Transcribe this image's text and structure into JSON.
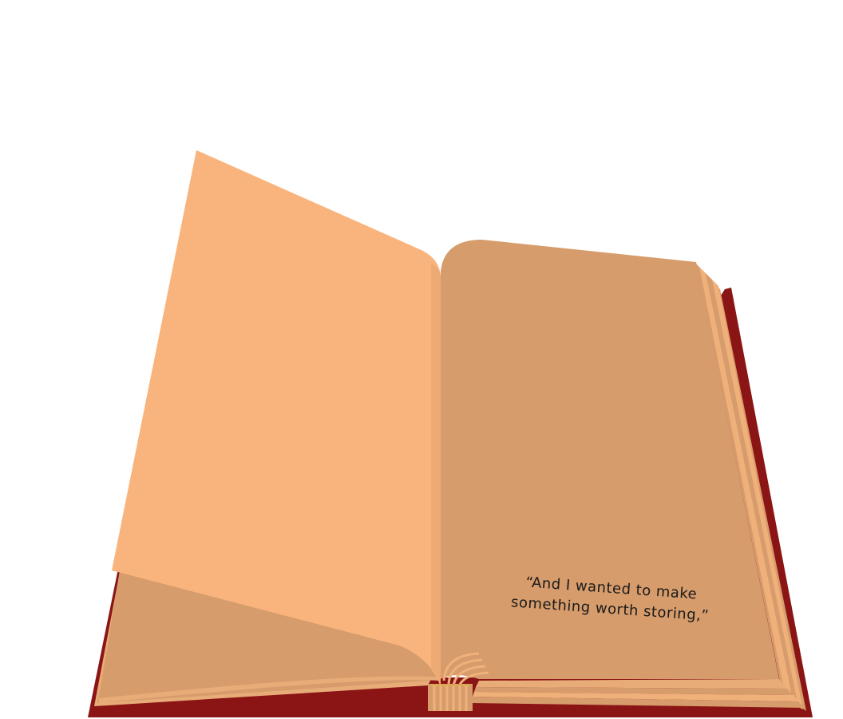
{
  "book": {
    "quote_line_1": "“And I wanted to make",
    "quote_line_2": "something worth storing,”"
  },
  "colors": {
    "cover": "#8B1515",
    "cover_dark": "#6E0F0F",
    "page_base": "#D69C6C",
    "page_light": "#F8B47C",
    "page_edge_line": "#E8AC78",
    "page_shadow": "#C98E60",
    "text": "#1a1a1a",
    "bookmark": "#E0B43A"
  }
}
